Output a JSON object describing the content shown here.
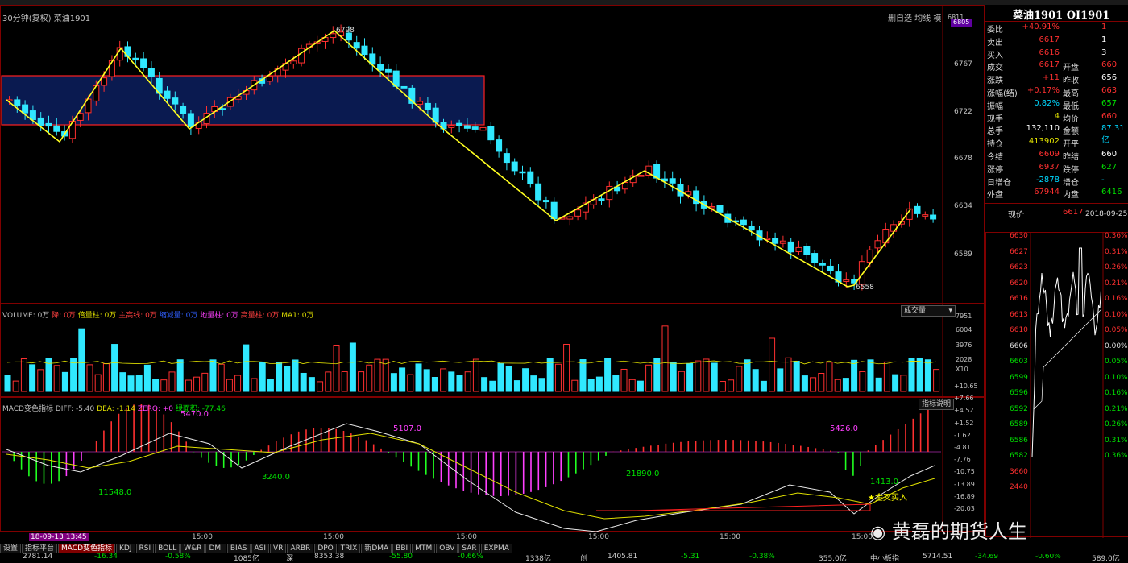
{
  "header": {
    "chart_title": "30分钟(复权) 菜油1901",
    "right_tools": "删自选 均线 模"
  },
  "price_axis": [
    "6811",
    "6805",
    "6767",
    "6722",
    "6678",
    "6634",
    "6589"
  ],
  "annotations": {
    "high": "6798",
    "low": "6558"
  },
  "volume_panel": {
    "legend": [
      {
        "text": "VOLUME: 0万",
        "color": "#c0c0c0"
      },
      {
        "text": "降: 0万",
        "color": "#ff4040"
      },
      {
        "text": "倍量柱: 0万",
        "color": "#e0e000"
      },
      {
        "text": "主高线: 0万",
        "color": "#ff4040"
      },
      {
        "text": "缩减量: 0万",
        "color": "#3060ff"
      },
      {
        "text": "地量柱: 0万",
        "color": "#ff40ff"
      },
      {
        "text": "高量柱: 0万",
        "color": "#ff4040"
      },
      {
        "text": "MA1: 0万",
        "color": "#e0e000"
      }
    ],
    "select_label": "成交量",
    "axis": [
      "7951",
      "6004",
      "3976",
      "2028",
      "X10"
    ]
  },
  "macd_panel": {
    "legend": [
      {
        "text": "MACD变色指标",
        "color": "#c0c0c0"
      },
      {
        "text": "DIFF: -5.40",
        "color": "#c0c0c0"
      },
      {
        "text": "DEA: -1.14",
        "color": "#e0e000"
      },
      {
        "text": "ZERO: +0",
        "color": "#ff40ff"
      },
      {
        "text": "绿面积: -77.46",
        "color": "#00e000"
      }
    ],
    "help_button": "指标说明",
    "axis": [
      "+10.65",
      "+7.66",
      "+4.52",
      "+1.52",
      "-1.62",
      "-4.81",
      "-7.76",
      "-10.75",
      "-13.89",
      "-16.89",
      "-20.03"
    ],
    "labels": {
      "a": "5470.0",
      "b": "11548.0",
      "c": "3240.0",
      "d": "5107.0",
      "e": "21890.0",
      "f": "5426.0",
      "g": "1413.0"
    },
    "golden_cross": "金叉买入"
  },
  "time_axis": {
    "date": "18-09-13 13:45",
    "ticks": [
      "15:00",
      "15:00",
      "15:00",
      "15:00",
      "15:00",
      "15:00"
    ]
  },
  "tabs": [
    "设置",
    "指标平台",
    "MACD变色指标",
    "KDJ",
    "RSI",
    "BOLL",
    "W&R",
    "DMI",
    "BIAS",
    "ASI",
    "VR",
    "ARBR",
    "DPO",
    "TRIX",
    "新DMA",
    "BBI",
    "MTM",
    "OBV",
    "SAR",
    "EXPMA"
  ],
  "status_bar": [
    "2781.14",
    "-16.34",
    "-0.58%",
    "1085亿",
    "深",
    "8353.38",
    "-55.80",
    "-0.66%",
    "1338亿",
    "创",
    "1405.81",
    "-5.31",
    "-0.38%",
    "355.0亿",
    "中小板指",
    "5714.51",
    "-34.69",
    "-0.60%",
    "589.0亿"
  ],
  "right_panel": {
    "title": "菜油1901 OI1901",
    "rows": [
      {
        "k": "委比",
        "v": "+40.91%",
        "vc": "red",
        "k2": "",
        "v2": "1",
        "v2c": "red"
      },
      {
        "k": "卖出",
        "v": "6617",
        "vc": "red",
        "k2": "",
        "v2": "1",
        "v2c": "white"
      },
      {
        "k": "买入",
        "v": "6616",
        "vc": "red",
        "k2": "",
        "v2": "3",
        "v2c": "white"
      },
      {
        "k": "成交",
        "v": "6617",
        "vc": "red",
        "k2": "开盘",
        "v2": "660",
        "v2c": "red"
      },
      {
        "k": "涨跌",
        "v": "+11",
        "vc": "red",
        "k2": "昨收",
        "v2": "656",
        "v2c": "white"
      },
      {
        "k": "涨幅(结)",
        "v": "+0.17%",
        "vc": "red",
        "k2": "最高",
        "v2": "663",
        "v2c": "red"
      },
      {
        "k": "振幅",
        "v": "0.82%",
        "vc": "cyan",
        "k2": "最低",
        "v2": "657",
        "v2c": "green"
      },
      {
        "k": "现手",
        "v": "4",
        "vc": "yellow",
        "k2": "均价",
        "v2": "660",
        "v2c": "red"
      },
      {
        "k": "总手",
        "v": "132,110",
        "vc": "white",
        "k2": "金额",
        "v2": "87.31亿",
        "v2c": "cyan"
      },
      {
        "k": "持仓",
        "v": "413902",
        "vc": "yellow",
        "k2": "开平",
        "v2": "",
        "v2c": "white"
      },
      {
        "k": "今结",
        "v": "6609",
        "vc": "red",
        "k2": "昨结",
        "v2": "660",
        "v2c": "white"
      },
      {
        "k": "涨停",
        "v": "6937",
        "vc": "red",
        "k2": "跌停",
        "v2": "627",
        "v2c": "green"
      },
      {
        "k": "日增仓",
        "v": "-2878",
        "vc": "cyan",
        "k2": "增仓",
        "v2": "-",
        "v2c": "cyan"
      },
      {
        "k": "外盘",
        "v": "67944",
        "vc": "red",
        "k2": "内盘",
        "v2": "6416",
        "v2c": "green"
      }
    ],
    "price_label": "现价",
    "price_value": "6617",
    "price_date": "2018-09-25,二",
    "mini_axis_left": [
      "6630",
      "6627",
      "6623",
      "6620",
      "6616",
      "6613",
      "6610",
      "6606",
      "6603",
      "6599",
      "6596",
      "6592",
      "6589",
      "6586",
      "6582",
      "3660",
      "2440"
    ],
    "mini_axis_right": [
      "0.36%",
      "0.31%",
      "0.26%",
      "0.21%",
      "0.16%",
      "0.10%",
      "0.05%",
      "0.00%",
      "0.05%",
      "0.10%",
      "0.16%",
      "0.21%",
      "0.26%",
      "0.31%",
      "0.36%"
    ]
  },
  "watermark": "黄磊的期货人生"
}
